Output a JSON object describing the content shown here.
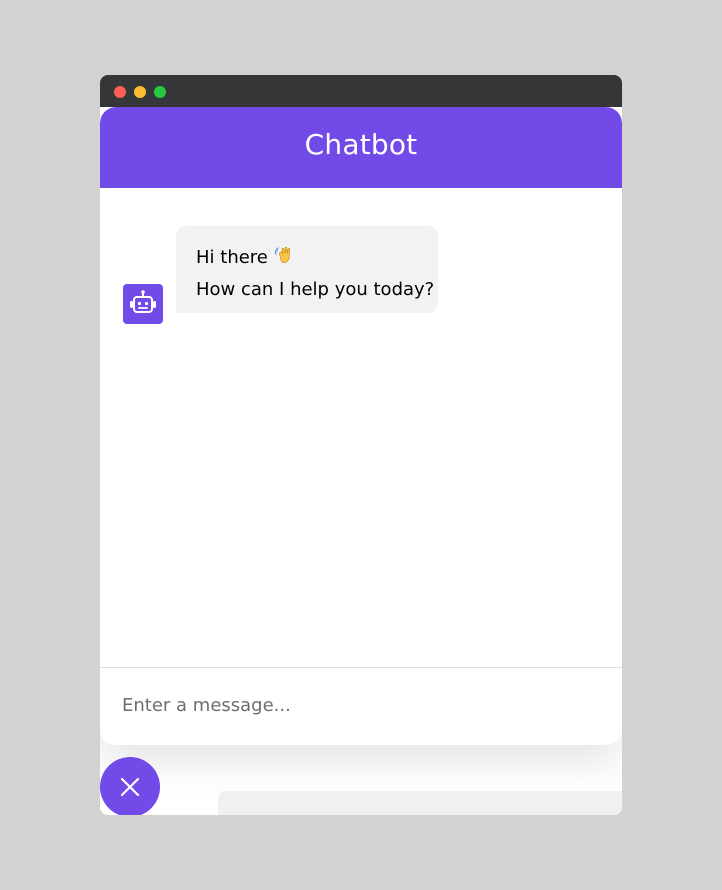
{
  "window": {
    "controls": [
      "close",
      "minimize",
      "maximize"
    ]
  },
  "chatbot": {
    "title": "Chatbot",
    "messages": [
      {
        "sender": "bot",
        "lines": [
          "Hi there",
          "How can I help you today?"
        ],
        "emoji": "waving-hand"
      }
    ],
    "input": {
      "placeholder": "Enter a message...",
      "value": ""
    },
    "toggler_icon": "close-icon",
    "avatar_icon": "robot-icon"
  },
  "colors": {
    "accent": "#724ae8",
    "bubble": "#f2f2f2",
    "titlebar": "#343638",
    "page_bg": "#d2d2d2"
  }
}
